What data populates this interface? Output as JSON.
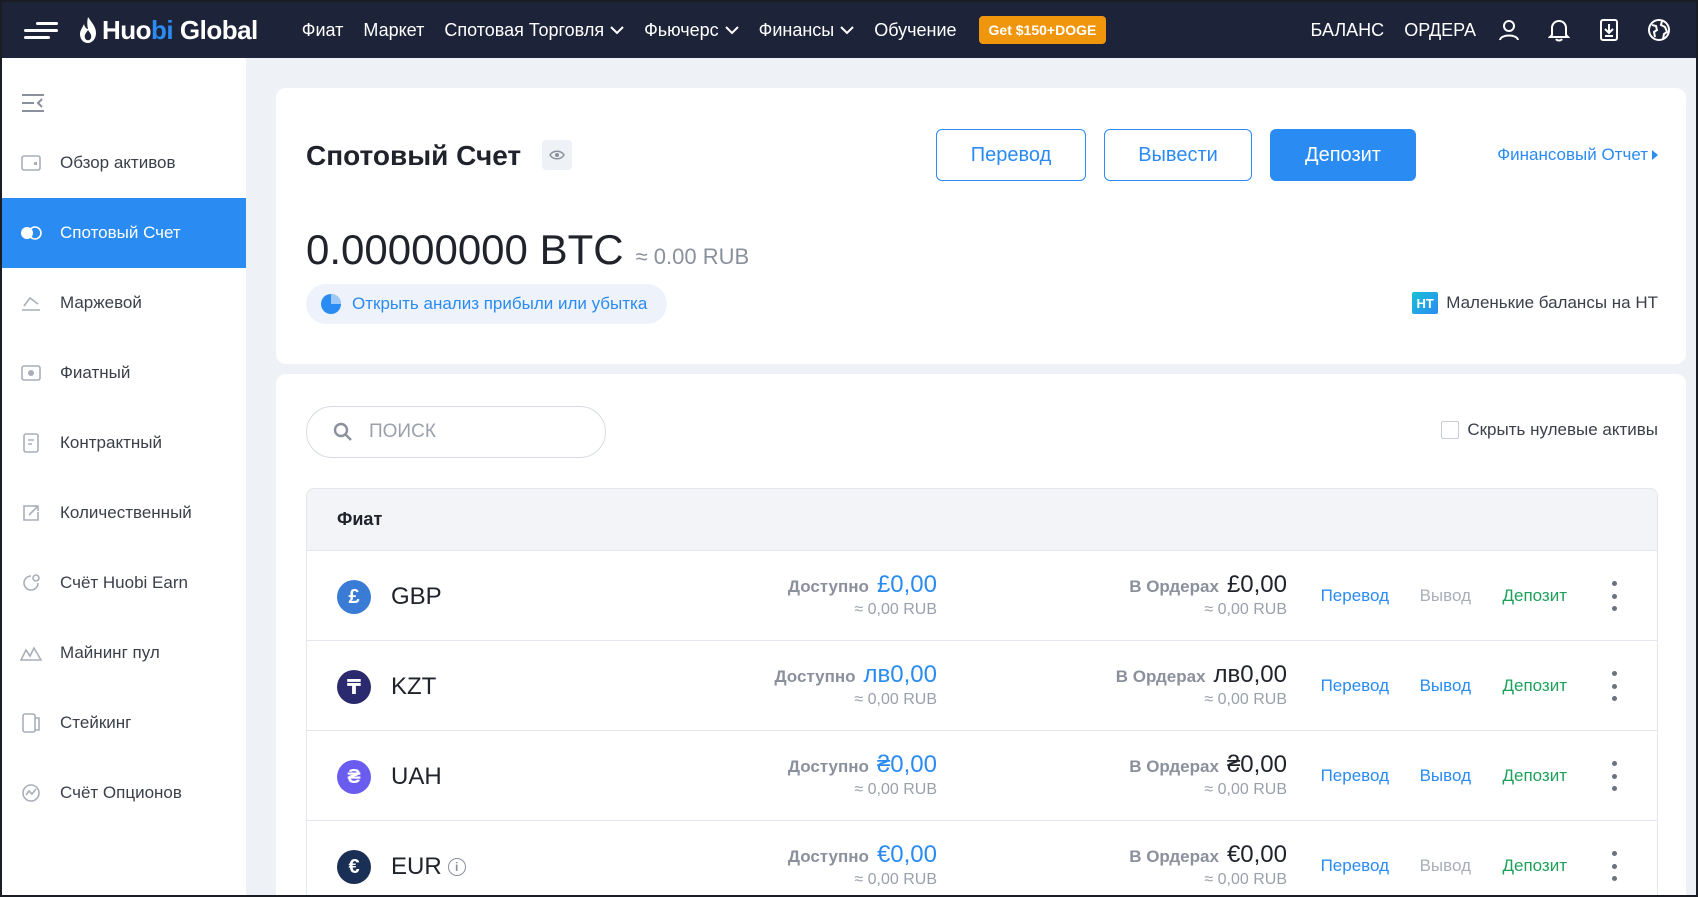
{
  "nav": {
    "logo_text_a": "Huo",
    "logo_text_b": "bi",
    "logo_text_c": " Global",
    "items": [
      {
        "label": "Фиат",
        "dropdown": false
      },
      {
        "label": "Маркет",
        "dropdown": false
      },
      {
        "label": "Спотовая Торговля",
        "dropdown": true
      },
      {
        "label": "Фьючерс",
        "dropdown": true
      },
      {
        "label": "Финансы",
        "dropdown": true
      },
      {
        "label": "Обучение",
        "dropdown": false
      }
    ],
    "promo": "Get $150+DOGE",
    "balance": "БАЛАНС",
    "orders": "ОРДЕРА",
    "icons": [
      "user-icon",
      "bell-icon",
      "download-icon",
      "globe-icon"
    ]
  },
  "sidebar": {
    "items": [
      {
        "label": "Обзор активов",
        "icon": "wallet-icon",
        "active": false
      },
      {
        "label": "Спотовый Счет",
        "icon": "spot-icon",
        "active": true
      },
      {
        "label": "Маржевой",
        "icon": "margin-icon",
        "active": false
      },
      {
        "label": "Фиатный",
        "icon": "fiat-icon",
        "active": false
      },
      {
        "label": "Контрактный",
        "icon": "contract-icon",
        "active": false
      },
      {
        "label": "Количественный",
        "icon": "quant-icon",
        "active": false
      },
      {
        "label": "Счёт Huobi Earn",
        "icon": "earn-icon",
        "active": false
      },
      {
        "label": "Майнинг пул",
        "icon": "mining-icon",
        "active": false
      },
      {
        "label": "Стейкинг",
        "icon": "staking-icon",
        "active": false
      },
      {
        "label": "Счёт Опционов",
        "icon": "options-icon",
        "active": false
      }
    ]
  },
  "account": {
    "title": "Спотовый Счет",
    "transfer": "Перевод",
    "withdraw": "Вывести",
    "deposit": "Депозит",
    "report": "Финансовый Отчет",
    "balance": "0.00000000 BTC",
    "balance_approx": "≈ 0.00 RUB",
    "pnl": "Открыть анализ прибыли или убытка",
    "ht_badge": "HT",
    "small_balances": "Маленькие балансы на HT"
  },
  "assets": {
    "search_placeholder": "ПОИСК",
    "hide_zero": "Скрыть нулевые активы",
    "section": "Фиат",
    "available_label": "Доступно",
    "orders_label": "В Ордерах",
    "action_transfer": "Перевод",
    "action_withdraw": "Вывод",
    "action_deposit": "Депозит",
    "rows": [
      {
        "symbol": "£",
        "name": "GBP",
        "color": "#3a7bd5",
        "available": "£0,00",
        "available_rub": "≈ 0,00 RUB",
        "orders": "£0,00",
        "orders_rub": "≈ 0,00 RUB",
        "withdraw_enabled": false,
        "info": false
      },
      {
        "symbol": "₸",
        "name": "KZT",
        "color": "#2b2a6e",
        "available": "лв0,00",
        "available_rub": "≈ 0,00 RUB",
        "orders": "лв0,00",
        "orders_rub": "≈ 0,00 RUB",
        "withdraw_enabled": true,
        "info": false
      },
      {
        "symbol": "₴",
        "name": "UAH",
        "color": "#6b5cf0",
        "available": "₴0,00",
        "available_rub": "≈ 0,00 RUB",
        "orders": "₴0,00",
        "orders_rub": "≈ 0,00 RUB",
        "withdraw_enabled": true,
        "info": false
      },
      {
        "symbol": "€",
        "name": "EUR",
        "color": "#1a2f55",
        "available": "€0,00",
        "available_rub": "≈ 0,00 RUB",
        "orders": "€0,00",
        "orders_rub": "≈ 0,00 RUB",
        "withdraw_enabled": false,
        "info": true
      }
    ]
  }
}
